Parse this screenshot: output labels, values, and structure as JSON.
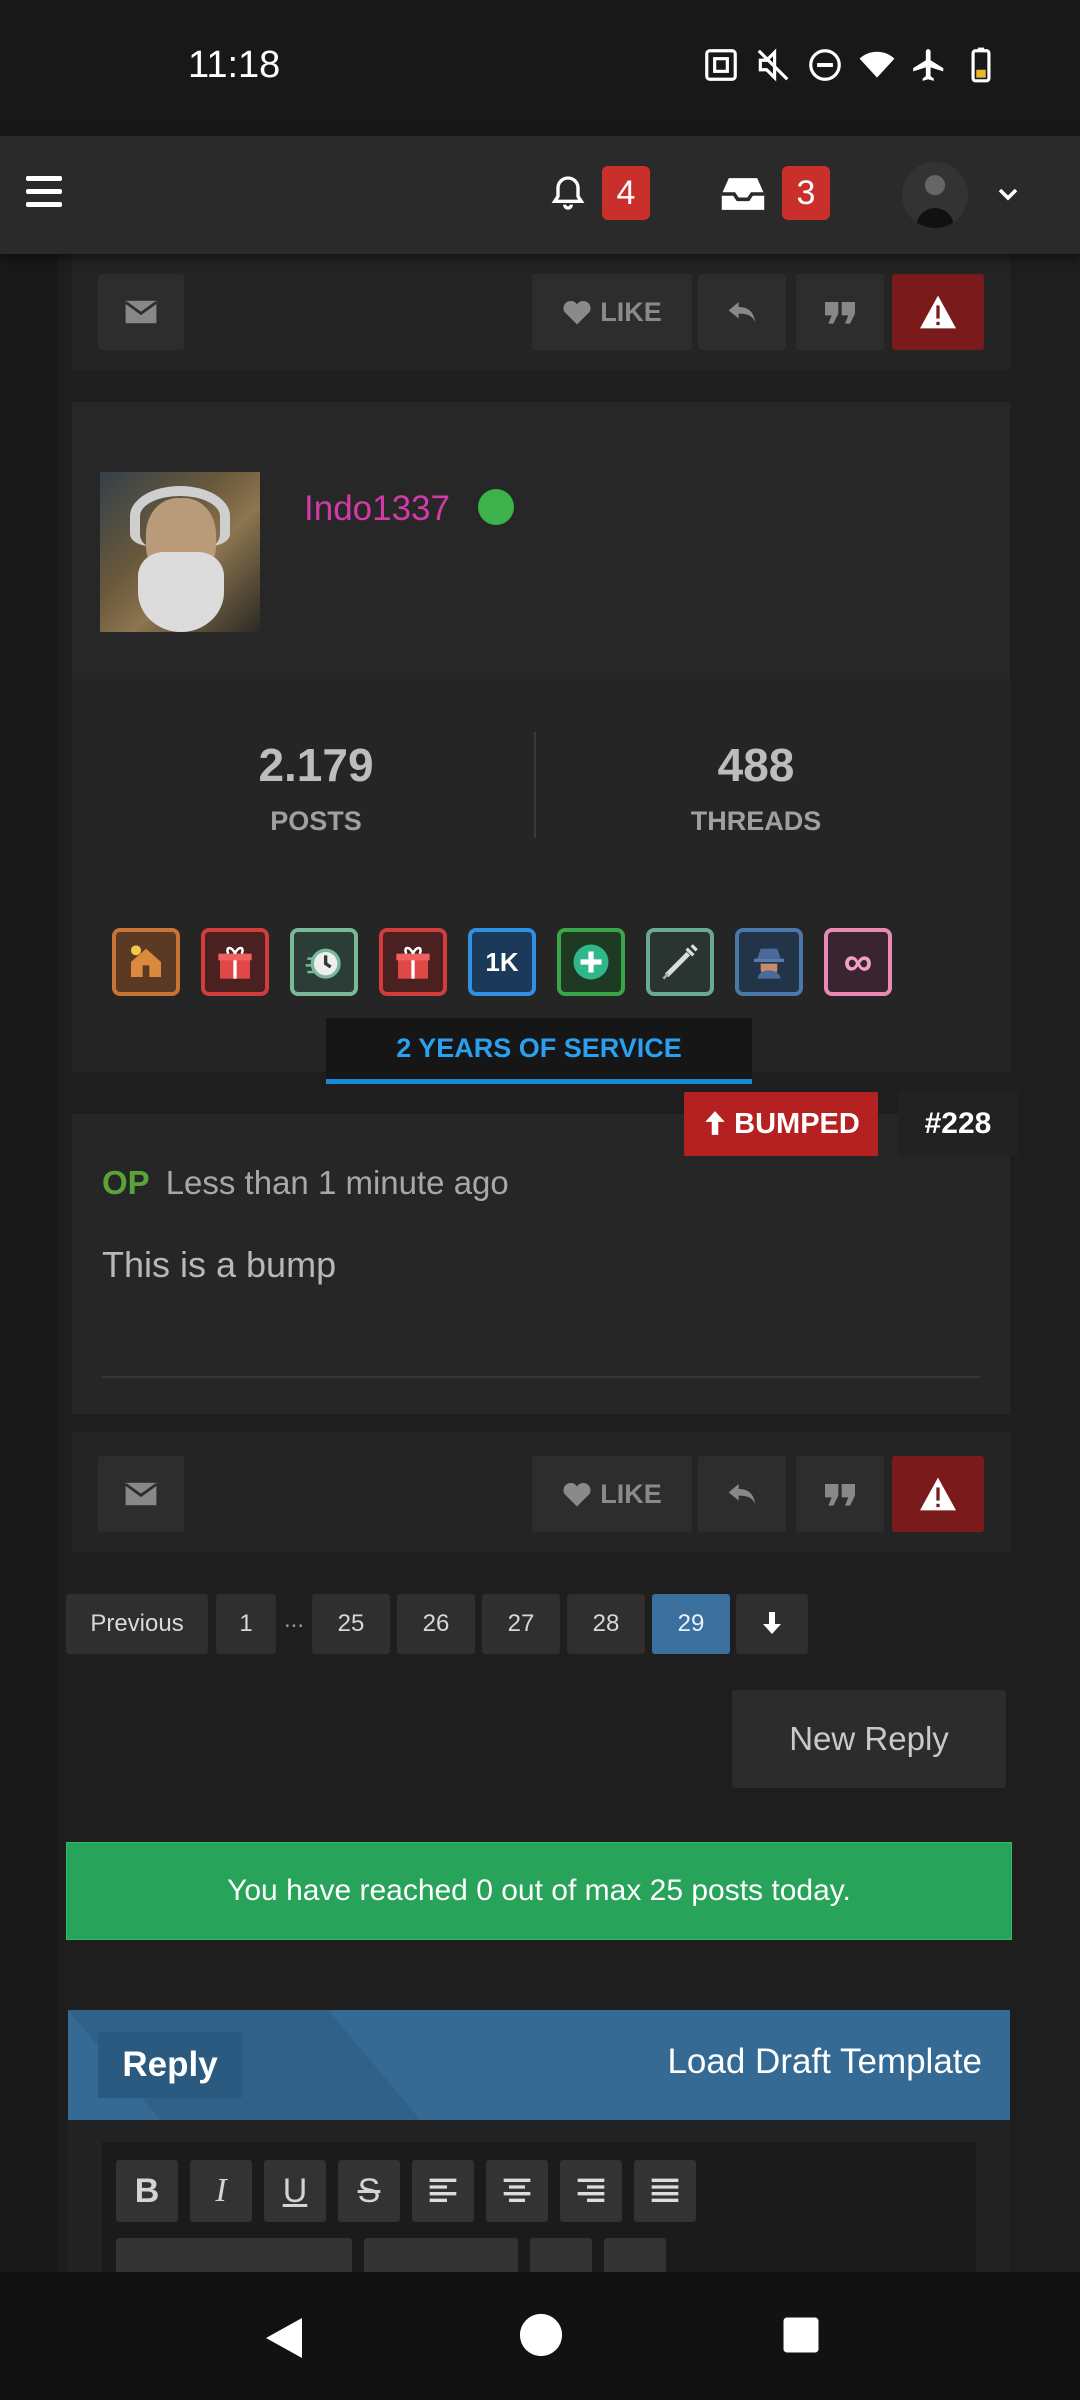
{
  "status": {
    "time": "11:18"
  },
  "nav": {
    "notifications_count": "4",
    "inbox_count": "3"
  },
  "post": {
    "username": "Indo1337",
    "posts_value": "2.179",
    "posts_label": "POSTS",
    "threads_value": "488",
    "threads_label": "THREADS",
    "trophies": [
      {
        "icon": "house-icon",
        "color": "#c87436"
      },
      {
        "icon": "gift-icon",
        "color": "#d13d3d"
      },
      {
        "icon": "stopwatch-icon",
        "color": "#7ab89a"
      },
      {
        "icon": "gift-icon",
        "color": "#d13d3d"
      },
      {
        "icon": "1k-icon",
        "label": "1K",
        "color": "#2f8fe0"
      },
      {
        "icon": "plus-icon",
        "color": "#3aa64a"
      },
      {
        "icon": "syringe-icon",
        "color": "#6aa89a"
      },
      {
        "icon": "spy-icon",
        "color": "#4a78a8"
      },
      {
        "icon": "infinity-icon",
        "label": "∞",
        "color": "#e88ab4"
      }
    ],
    "service_label": "2 YEARS OF SERVICE",
    "bumped_label": "BUMPED",
    "number": "#228",
    "op_label": "OP",
    "time_ago": "Less than 1 minute ago",
    "content": "This is a bump",
    "like_label": "LIKE"
  },
  "pagination": {
    "previous": "Previous",
    "pages": [
      "1",
      "25",
      "26",
      "27",
      "28",
      "29"
    ],
    "ellipsis": "...",
    "active": "29"
  },
  "new_reply_label": "New Reply",
  "notice": "You have reached 0 out of max 25 posts today.",
  "reply": {
    "tab_label": "Reply",
    "load_draft_label": "Load Draft Template",
    "toolbar": [
      "bold",
      "italic",
      "underline",
      "strikethrough",
      "align-left",
      "align-center",
      "align-right",
      "justify"
    ]
  },
  "colors": {
    "accent": "#356a94",
    "danger": "#b52020",
    "success": "#27a35a",
    "username": "#d33aa8"
  }
}
